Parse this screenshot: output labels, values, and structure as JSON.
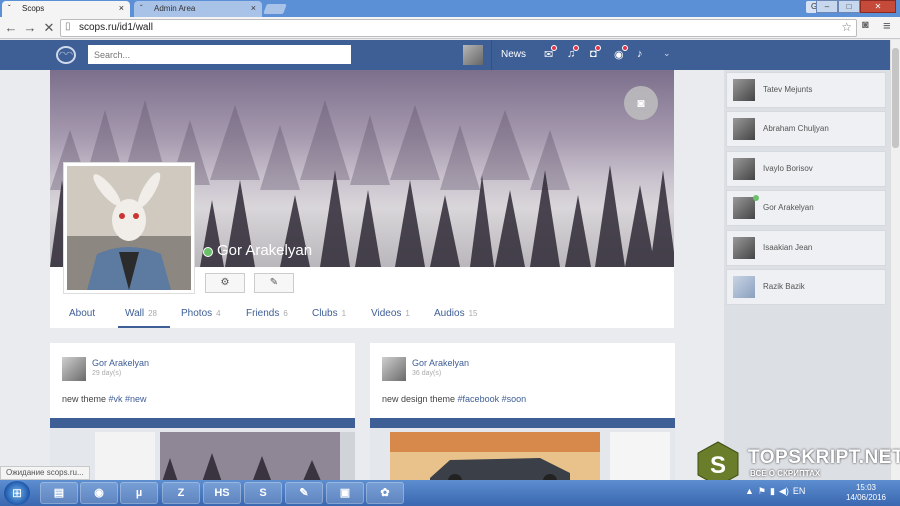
{
  "browser": {
    "tabs": [
      {
        "label": "Scops",
        "icon": "page-icon"
      },
      {
        "label": "Admin Area",
        "icon": "page-icon"
      }
    ],
    "user_badge": "Gor",
    "window_buttons": [
      "–",
      "□",
      "✕"
    ],
    "url": "scops.ru/id1/wall",
    "status_text": "Ожидание scops.ru..."
  },
  "header": {
    "logo_icon": "owl-logo-icon",
    "search_placeholder": "Search...",
    "news_label": "News",
    "notification_icons": [
      "mail-icon",
      "bell-icon",
      "chat-icon",
      "eye-icon",
      "music-icon"
    ]
  },
  "profile": {
    "name": "Gor Arakelyan",
    "status": "online",
    "tabs": [
      {
        "label": "About",
        "count": ""
      },
      {
        "label": "Wall",
        "count": "28"
      },
      {
        "label": "Photos",
        "count": "4"
      },
      {
        "label": "Friends",
        "count": "6"
      },
      {
        "label": "Clubs",
        "count": "1"
      },
      {
        "label": "Videos",
        "count": "1"
      },
      {
        "label": "Audios",
        "count": "15"
      }
    ],
    "active_tab": "Wall"
  },
  "posts": [
    {
      "author": "Gor Arakelyan",
      "date": "29 day(s)",
      "text": "new theme ",
      "tags": "#vk #new"
    },
    {
      "author": "Gor Arakelyan",
      "date": "36 day(s)",
      "text": "new design theme ",
      "tags": "#facebook #soon"
    }
  ],
  "friends": [
    {
      "name": "Tatev Mejunts",
      "online": false
    },
    {
      "name": "Abraham Chuljyan",
      "online": false
    },
    {
      "name": "Ivaylo Borisov",
      "online": false
    },
    {
      "name": "Gor Arakelyan",
      "online": true
    },
    {
      "name": "Isaakian Jean",
      "online": false
    },
    {
      "name": "Razik Bazik",
      "online": false
    }
  ],
  "watermark": {
    "title": "TOPSKRIPT.NET",
    "subtitle": "ВСЕ О СКРИПТАХ",
    "logo_letter": "S"
  },
  "taskbar": {
    "items": [
      "folder-icon",
      "chrome-icon",
      "utorrent-icon",
      "filezilla-icon",
      "hs-icon",
      "skype-icon",
      "notepad-icon",
      "monitor-icon",
      "paint-icon"
    ],
    "item_glyphs": [
      "▤",
      "◉",
      "µ",
      "Z",
      "HS",
      "S",
      "✎",
      "▣",
      "✿"
    ],
    "lang": "EN",
    "time": "15:03",
    "date": "14/06/2016"
  },
  "colors": {
    "brand": "#3e5e96",
    "online": "#6bc16b",
    "notify": "#e1364b"
  }
}
